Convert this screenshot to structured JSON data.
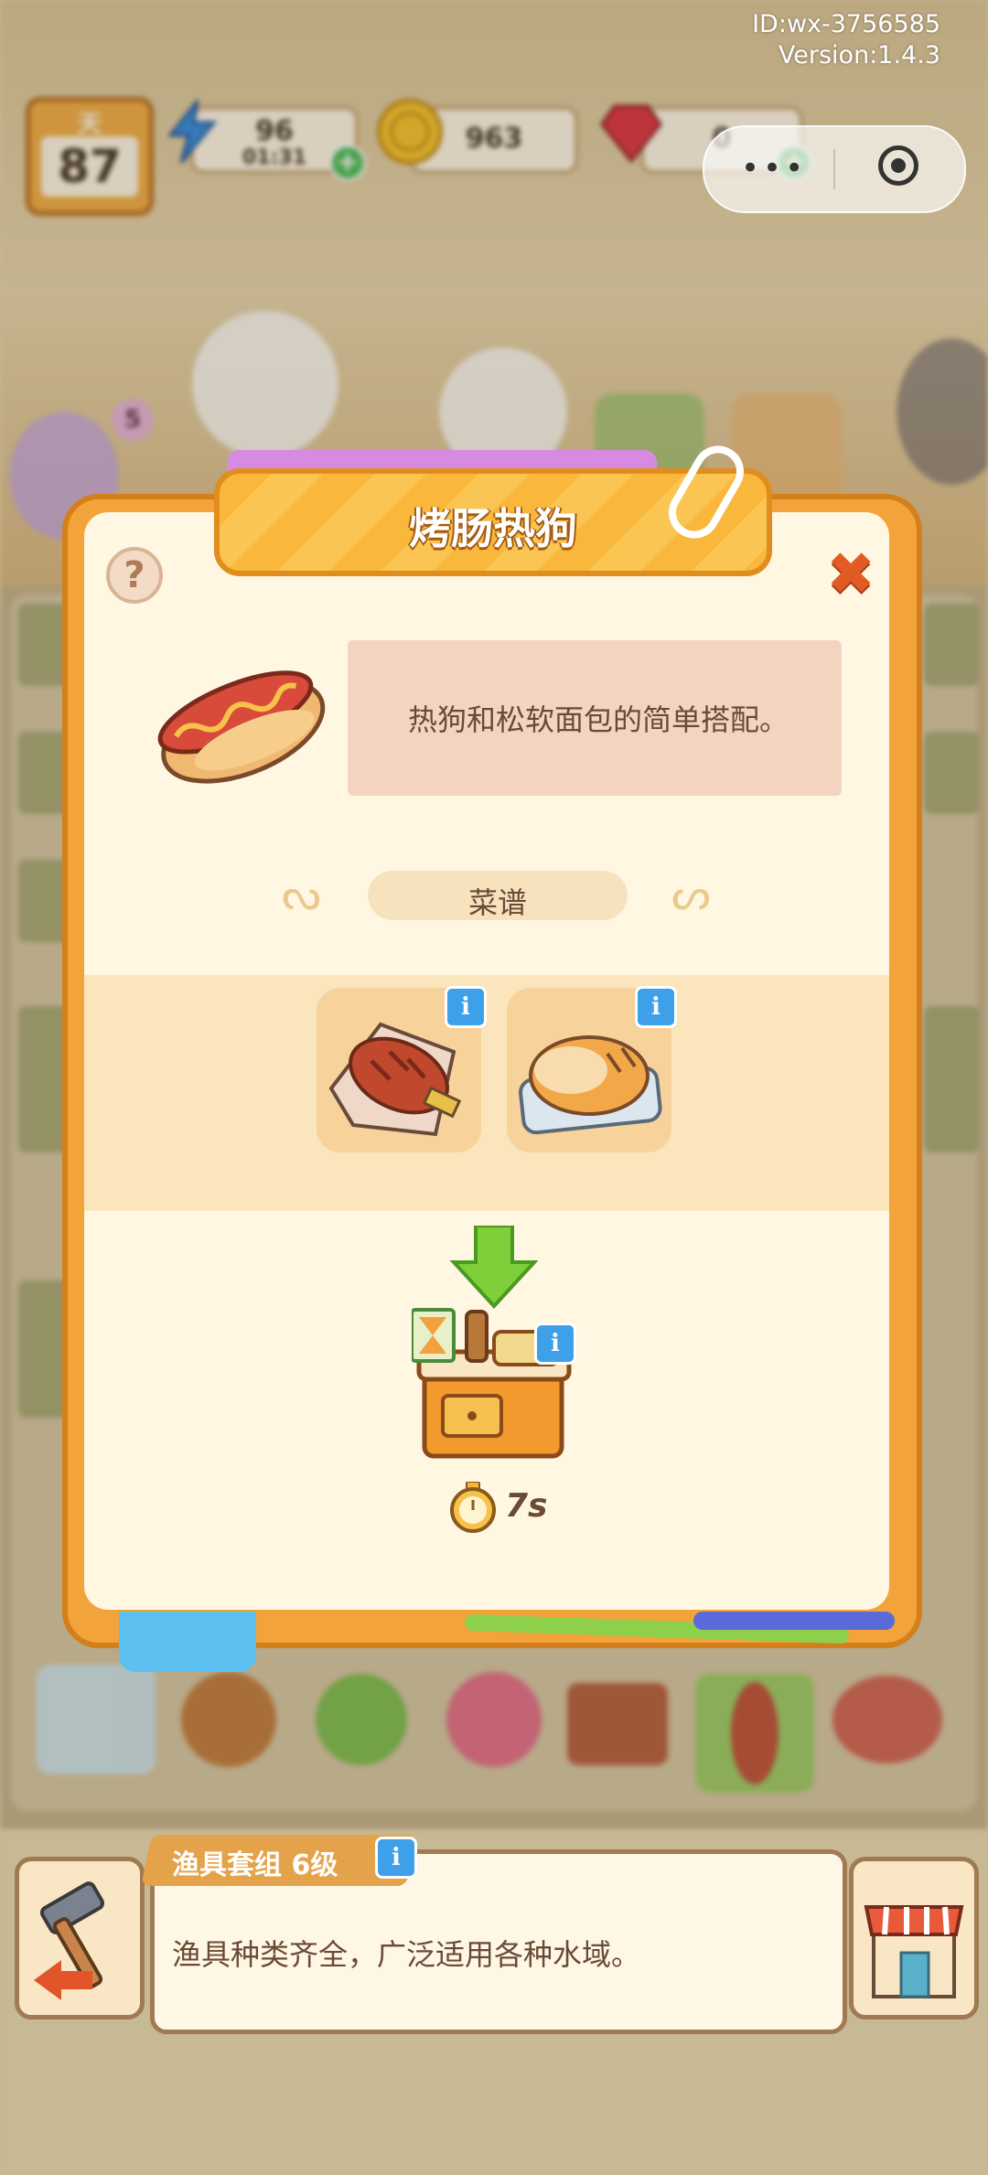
{
  "system": {
    "id_text": "ID:wx-3756585",
    "version_text": "Version:1.4.3",
    "capsule_more_icon": "more-dots-icon",
    "capsule_close_icon": "target-circle-icon"
  },
  "hud": {
    "day_label": "天",
    "day_value": "87",
    "energy_value": "96",
    "energy_timer": "01:31",
    "coins_value": "963",
    "gems_value": "0",
    "notification_count": "5"
  },
  "modal": {
    "title": "烤肠热狗",
    "description": "热狗和松软面包的简单搭配。",
    "recipe_label": "菜谱",
    "info_badge": "i",
    "help_label": "?",
    "close_label": "✖",
    "cook_time": "7s",
    "ingredients": [
      {
        "icon": "grilled-sausage-icon"
      },
      {
        "icon": "bread-roll-icon"
      }
    ],
    "result_station_icon": "kitchen-station-icon",
    "colors": {
      "panel": "#f2a33a",
      "panel_inner": "#fff7e2",
      "title": "#ffffff",
      "close": "#e25b24",
      "info_badge": "#3da0e8",
      "arrow": "#7fcf3a"
    }
  },
  "bottom_bar": {
    "item_title": "渔具套组 6级",
    "item_description": "渔具种类齐全，广泛适用各种水域。"
  }
}
